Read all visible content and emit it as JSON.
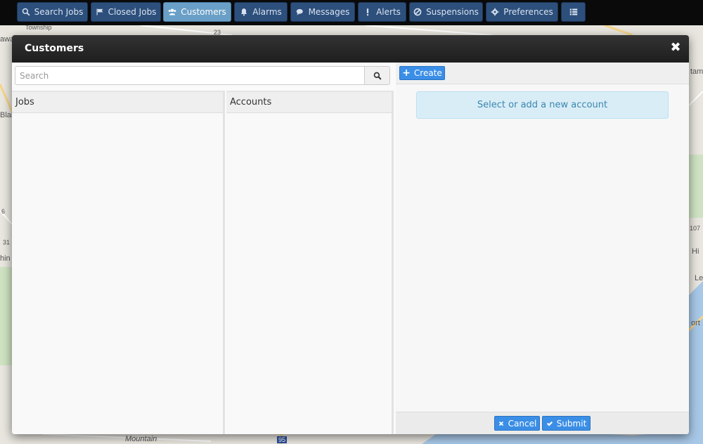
{
  "nav": {
    "items": [
      {
        "label": "Search Jobs",
        "icon": "search-icon"
      },
      {
        "label": "Closed Jobs",
        "icon": "flag-icon"
      },
      {
        "label": "Customers",
        "icon": "users-icon",
        "active": true
      },
      {
        "label": "Alarms",
        "icon": "bell-icon"
      },
      {
        "label": "Messages",
        "icon": "comments-icon"
      },
      {
        "label": "Alerts",
        "icon": "exclamation-icon"
      },
      {
        "label": "Suspensions",
        "icon": "ban-icon"
      },
      {
        "label": "Preferences",
        "icon": "gear-icon"
      },
      {
        "label": "",
        "icon": "list-icon"
      }
    ]
  },
  "map": {
    "labels": {
      "township": "Township",
      "mountain": "Mountain",
      "r23": "23",
      "r95": "95",
      "r107": "107",
      "r31": "31",
      "r6": "6",
      "hi": "Hi",
      "le": "Le",
      "ort": "ort",
      "tam": "tam",
      "awa": "awa",
      "blai": "Blai",
      "hin": "hin"
    }
  },
  "modal": {
    "title": "Customers",
    "search": {
      "placeholder": "Search"
    },
    "columns": {
      "jobs": "Jobs",
      "accounts": "Accounts"
    },
    "create_label": "Create",
    "info_message": "Select or add a new account",
    "cancel_label": "Cancel",
    "submit_label": "Submit"
  },
  "colors": {
    "nav_bg": "#2d4f7c",
    "nav_active": "#6aa0c7",
    "primary_button": "#3a8ee6",
    "info_bg": "#d9edf7",
    "info_text": "#3a87ad"
  }
}
